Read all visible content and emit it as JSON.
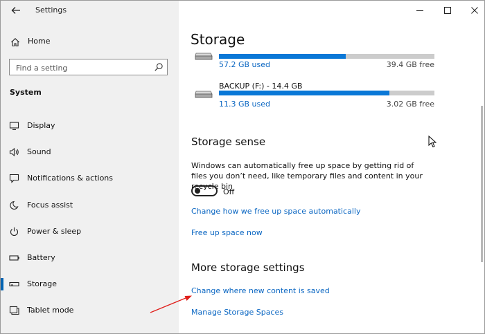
{
  "app": {
    "title": "Settings"
  },
  "sidebar": {
    "home_label": "Home",
    "search_placeholder": "Find a setting",
    "section": "System",
    "items": [
      {
        "label": "Display",
        "icon": "display-icon"
      },
      {
        "label": "Sound",
        "icon": "speaker-icon"
      },
      {
        "label": "Notifications & actions",
        "icon": "notification-icon"
      },
      {
        "label": "Focus assist",
        "icon": "moon-icon"
      },
      {
        "label": "Power & sleep",
        "icon": "power-icon"
      },
      {
        "label": "Battery",
        "icon": "battery-icon"
      },
      {
        "label": "Storage",
        "icon": "storage-icon",
        "active": true
      },
      {
        "label": "Tablet mode",
        "icon": "tablet-icon"
      }
    ]
  },
  "main": {
    "title": "Storage",
    "drives": [
      {
        "name": "",
        "used": "57.2 GB used",
        "free": "39.4 GB free",
        "used_fraction": 0.59
      },
      {
        "name": "BACKUP (F:) - 14.4 GB",
        "used": "11.3 GB used",
        "free": "3.02 GB free",
        "used_fraction": 0.79
      }
    ],
    "storage_sense": {
      "heading": "Storage sense",
      "description": "Windows can automatically free up space by getting rid of files you don’t need, like temporary files and content in your recycle bin",
      "toggle_state": "Off",
      "link_change": "Change how we free up space automatically",
      "link_free": "Free up space now"
    },
    "more": {
      "heading": "More storage settings",
      "link_new_content": "Change where new content is saved",
      "link_spaces": "Manage Storage Spaces"
    }
  },
  "colors": {
    "accent": "#0063b1",
    "bar": "#0a78d7",
    "link": "#0a66c2",
    "annotation": "#e0201c"
  }
}
